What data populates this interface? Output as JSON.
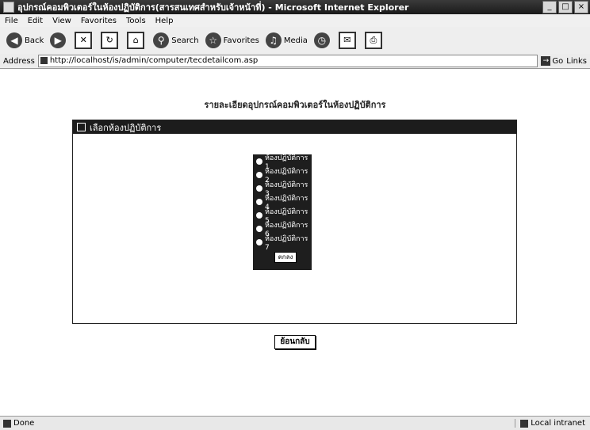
{
  "window": {
    "title": "อุปกรณ์คอมพิวเตอร์ในห้องปฏิบัติการ(สารสนเทศสำหรับเจ้าหน้าที่) - Microsoft Internet Explorer",
    "min_label": "_",
    "max_label": "□",
    "close_label": "×"
  },
  "menubar": {
    "items": [
      "File",
      "Edit",
      "View",
      "Favorites",
      "Tools",
      "Help"
    ]
  },
  "toolbar": {
    "back_label": "Back",
    "forward_label": "",
    "stop_label": "",
    "refresh_label": "",
    "home_label": "",
    "search_label": "Search",
    "favorites_label": "Favorites",
    "media_label": "Media"
  },
  "addressbar": {
    "label": "Address",
    "url": "http://localhost/is/admin/computer/tecdetailcom.asp",
    "go_label": "Go",
    "links_label": "Links"
  },
  "content": {
    "heading": "รายละเอียดอุปกรณ์คอมพิวเตอร์ในห้องปฏิบัติการ",
    "panel_title": "เลือกห้องปฏิบัติการ",
    "rooms": [
      "ห้องปฏิบัติการ 1",
      "ห้องปฏิบัติการ 2",
      "ห้องปฏิบัติการ 3",
      "ห้องปฏิบัติการ 4",
      "ห้องปฏิบัติการ 5",
      "ห้องปฏิบัติการ 6",
      "ห้องปฏิบัติการ 7"
    ],
    "ok_label": "ตกลง",
    "back_button_label": "ย้อนกลับ"
  },
  "statusbar": {
    "status": "Done",
    "zone": "Local intranet"
  }
}
